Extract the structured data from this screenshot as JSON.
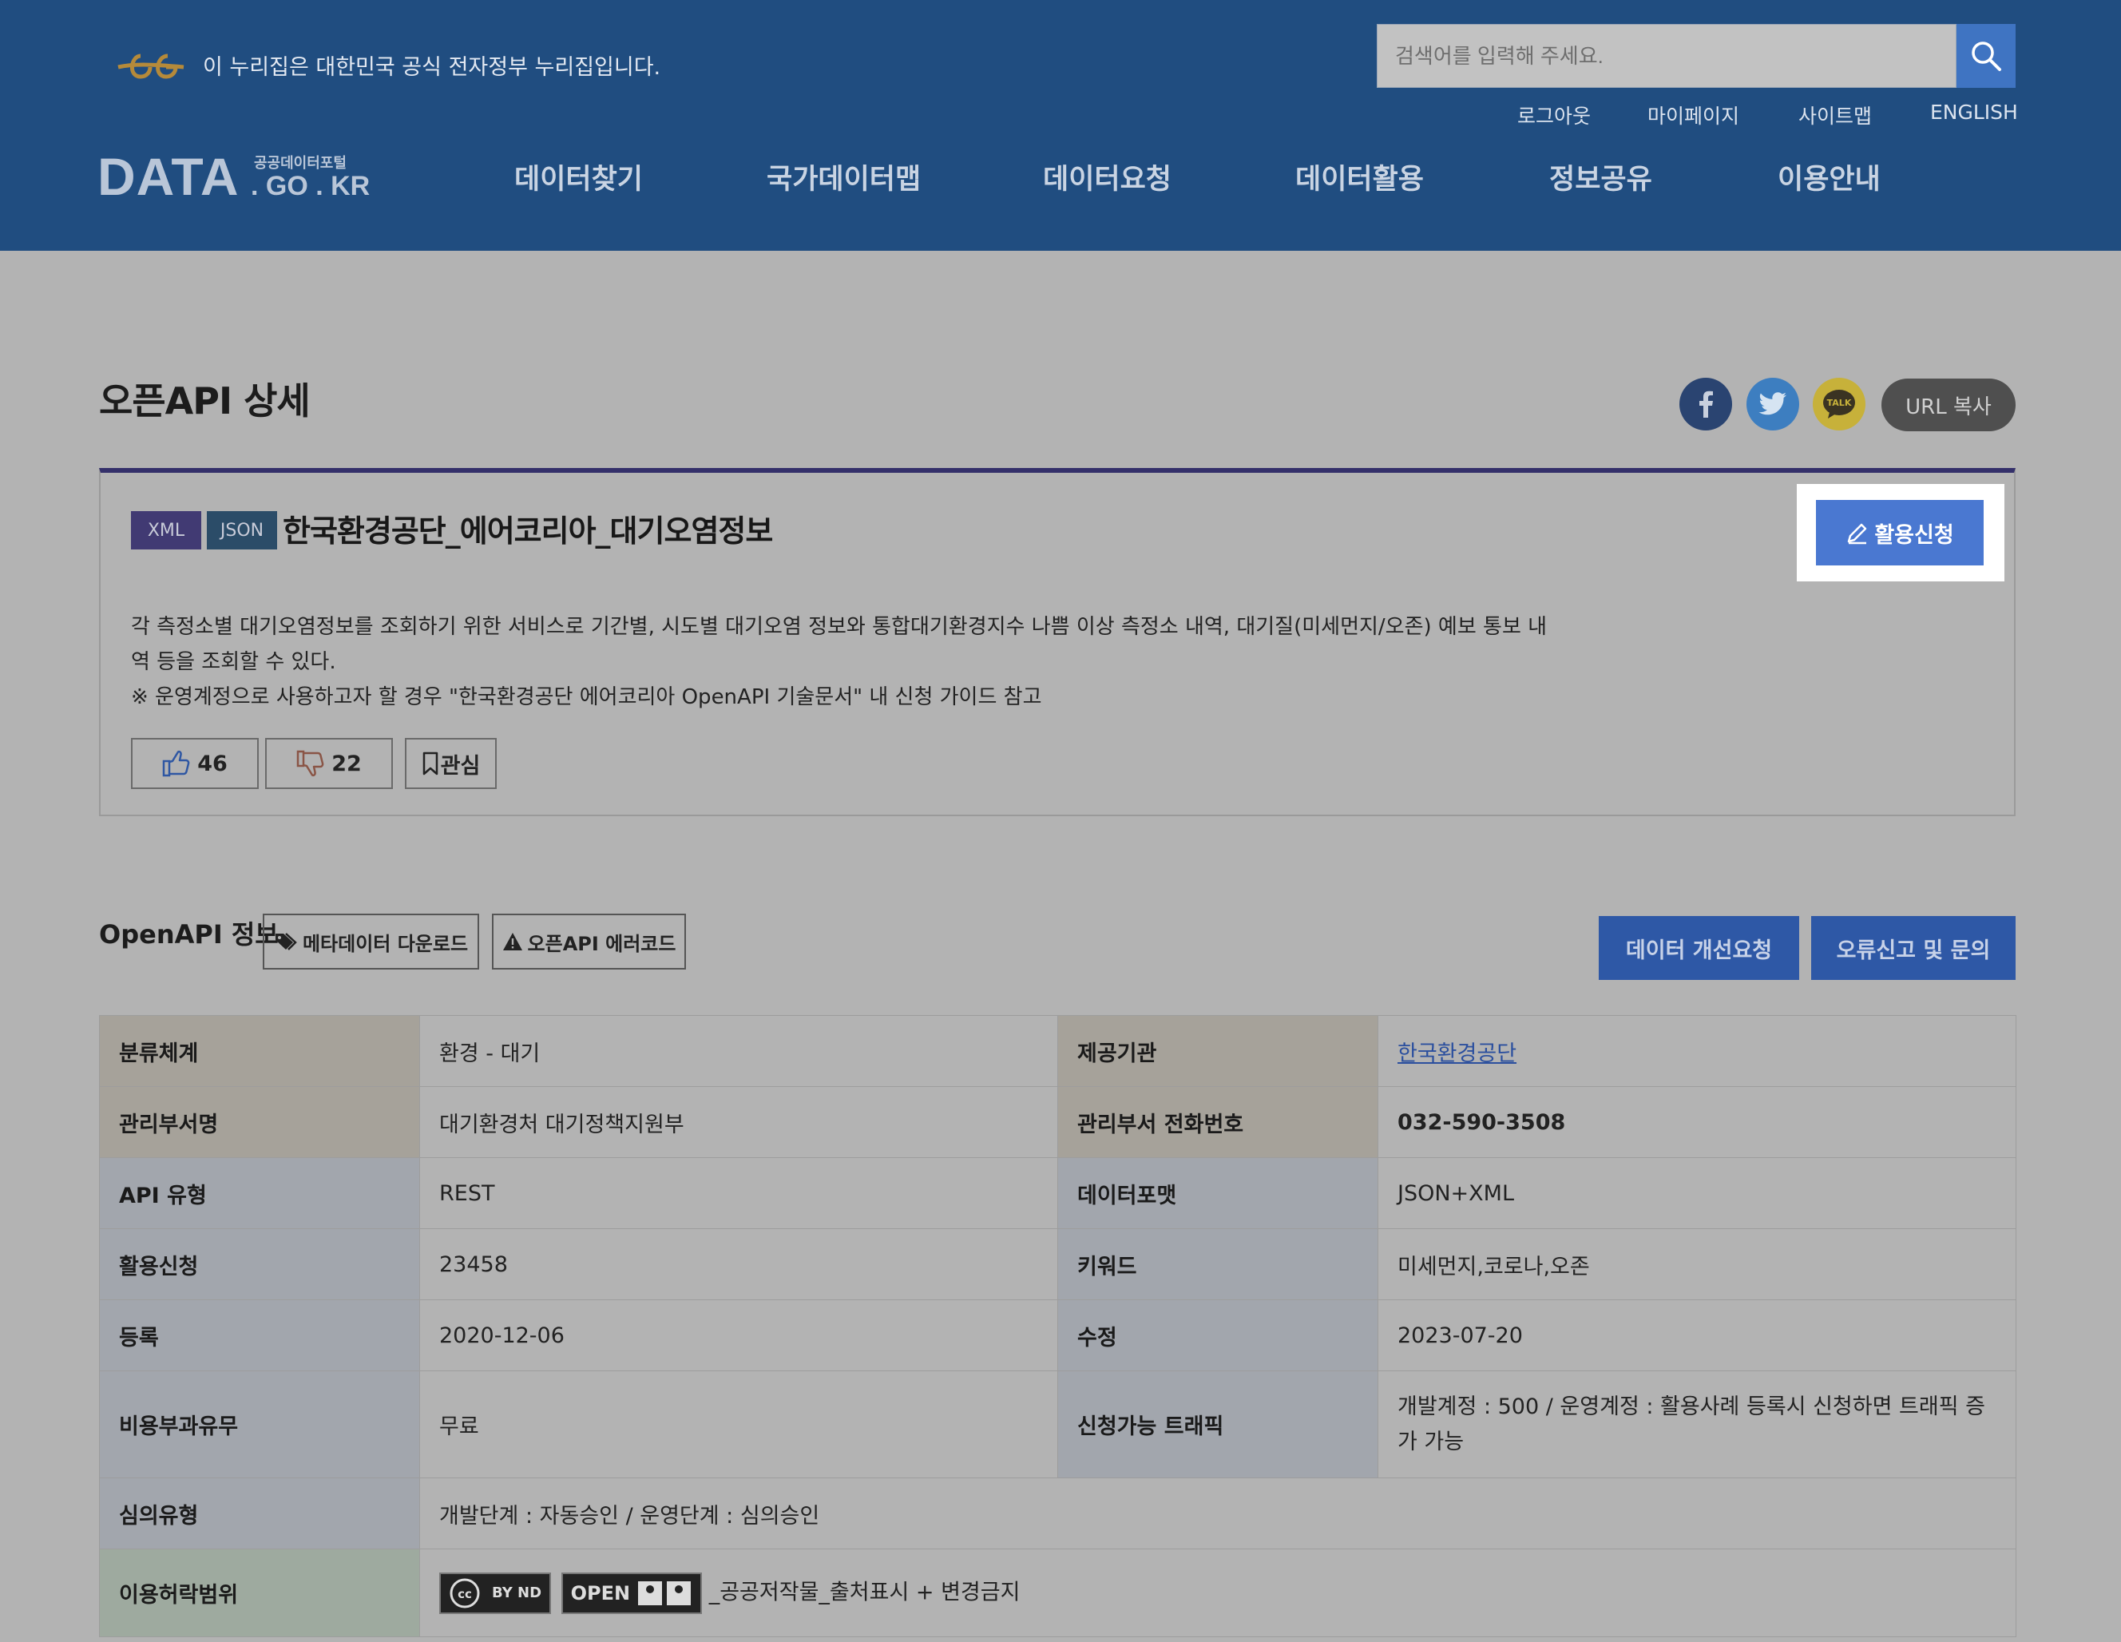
{
  "header": {
    "gov_notice": "이 누리집은 대한민국 공식 전자정부 누리집입니다.",
    "search_placeholder": "검색어를 입력해 주세요.",
    "util_links": [
      "로그아웃",
      "마이페이지",
      "사이트맵",
      "ENGLISH"
    ],
    "logo_main": "DATA",
    "logo_sub": "공공데이터포털",
    "logo_domain": ". GO . KR",
    "gnb": [
      "데이터찾기",
      "국가데이터맵",
      "데이터요청",
      "데이터활용",
      "정보공유",
      "이용안내"
    ],
    "colors": {
      "background": "#204d80",
      "search_button": "#3f74c2"
    }
  },
  "page": {
    "title": "오픈API 상세",
    "share": {
      "facebook_icon": "facebook-icon",
      "twitter_icon": "twitter-icon",
      "kakao_label": "TALK",
      "url_copy": "URL 복사"
    }
  },
  "api": {
    "formats": [
      "XML",
      "JSON"
    ],
    "title": "한국환경공단_에어코리아_대기오염정보",
    "apply_label": "활용신청",
    "description": [
      "각 측정소별 대기오염정보를 조회하기 위한 서비스로 기간별, 시도별 대기오염 정보와 통합대기환경지수 나쁨 이상 측정소 내역, 대기질(미세먼지/오존) 예보 통보 내",
      "역 등을 조회할 수 있다.",
      "※ 운영계정으로 사용하고자 할 경우 \"한국환경공단 에어코리아 OpenAPI 기술문서\" 내 신청 가이드 참고"
    ],
    "likes": "46",
    "dislikes": "22",
    "bookmark_label": "관심"
  },
  "info": {
    "section_title": "OpenAPI 정보",
    "metadata_download": "메타데이터 다운로드",
    "error_code": "오픈API 에러코드",
    "improve_request": "데이터 개선요청",
    "report_inquiry": "오류신고 및 문의",
    "rows": [
      {
        "l1": "분류체계",
        "v1": "환경 - 대기",
        "l2": "제공기관",
        "v2": "한국환경공단"
      },
      {
        "l1": "관리부서명",
        "v1": "대기환경처 대기정책지원부",
        "l2": "관리부서 전화번호",
        "v2": "032-590-3508"
      },
      {
        "l1": "API 유형",
        "v1": "REST",
        "l2": "데이터포맷",
        "v2": "JSON+XML"
      },
      {
        "l1": "활용신청",
        "v1": "23458",
        "l2": "키워드",
        "v2": "미세먼지,코로나,오존"
      },
      {
        "l1": "등록",
        "v1": "2020-12-06",
        "l2": "수정",
        "v2": "2023-07-20"
      },
      {
        "l1": "비용부과유무",
        "v1": "무료",
        "l2": "신청가능 트래픽",
        "v2": "개발계정 : 500 / 운영계정 : 활용사례 등록시 신청하면 트래픽 증가 가능"
      }
    ],
    "review_label": "심의유형",
    "review_value": "개발단계 : 자동승인 / 운영단계 : 심의승인",
    "license_label": "이용허락범위",
    "license_badge_cc": "BY  ND",
    "license_badge_open": "OPEN",
    "license_value": "_공공저작물_출처표시 + 변경금지"
  }
}
